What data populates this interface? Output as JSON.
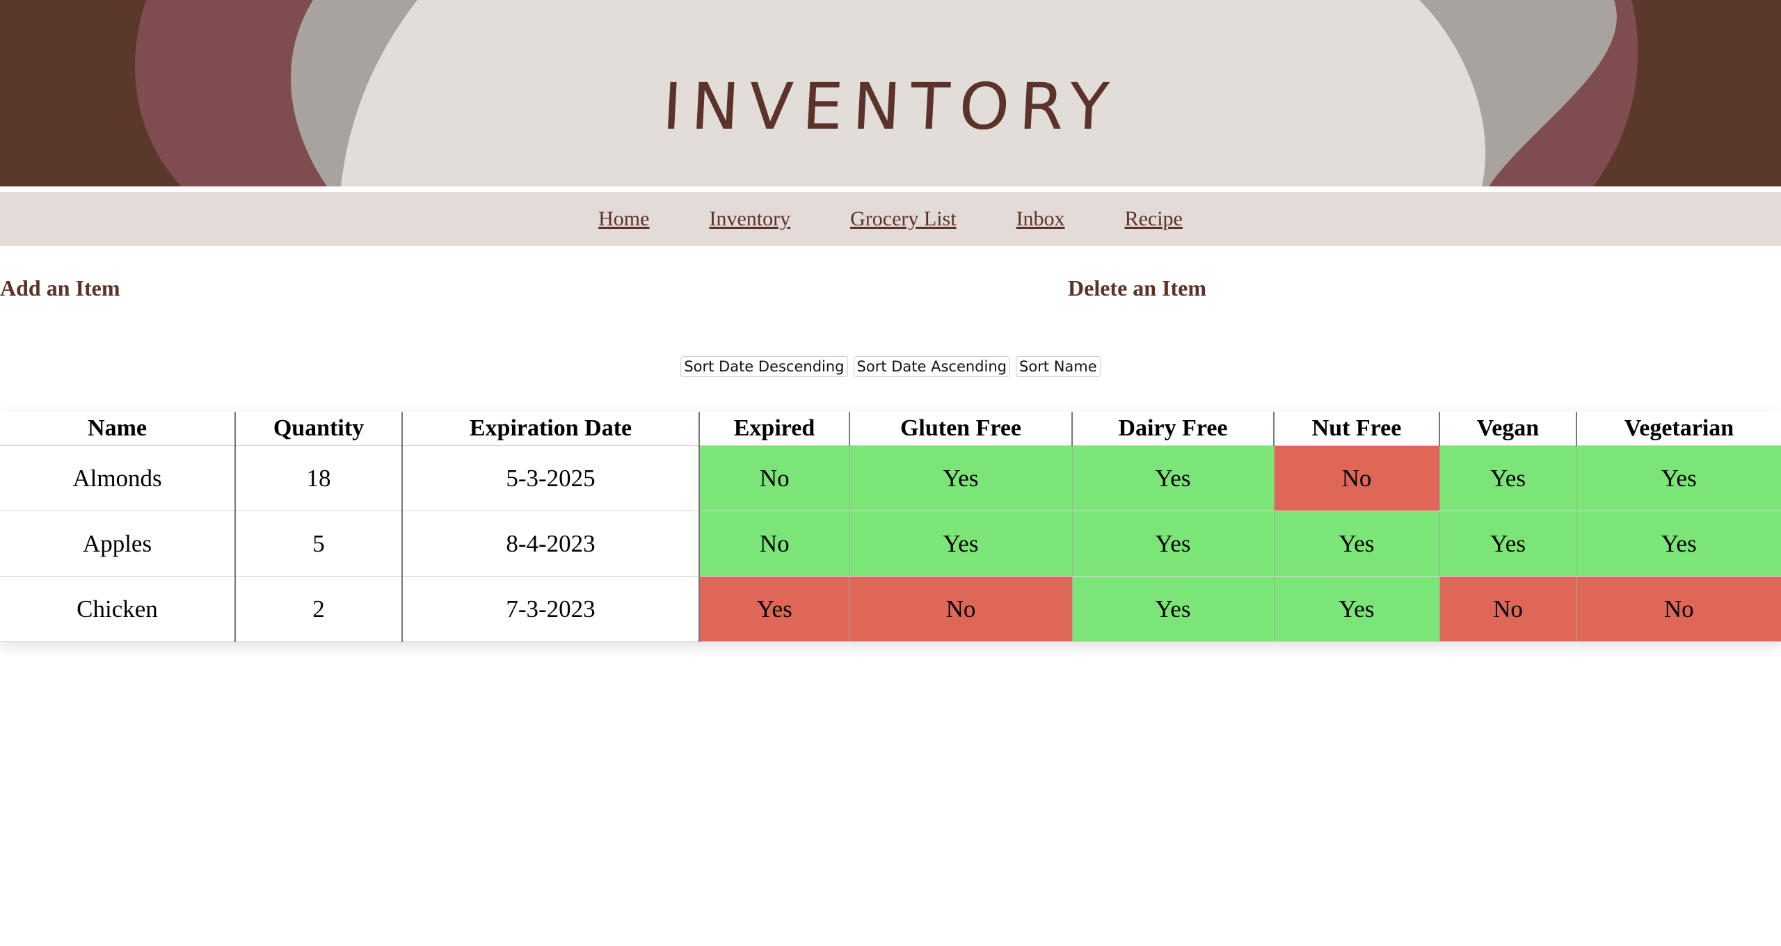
{
  "banner": {
    "title": "INVENTORY",
    "colors": {
      "outer": "#5b382c",
      "mid": "#7f4d4f",
      "inner": "#a8a39e",
      "center": "#e2ddd8"
    }
  },
  "nav": {
    "items": [
      {
        "label": "Home"
      },
      {
        "label": "Inventory"
      },
      {
        "label": "Grocery List"
      },
      {
        "label": "Inbox"
      },
      {
        "label": "Recipe"
      }
    ]
  },
  "actions": {
    "add_label": "Add an Item",
    "delete_label": "Delete an Item"
  },
  "sort": {
    "desc_label": "Sort Date Descending",
    "asc_label": "Sort Date Ascending",
    "name_label": "Sort Name"
  },
  "table": {
    "headers": [
      "Name",
      "Quantity",
      "Expiration Date",
      "Expired",
      "Gluten Free",
      "Dairy Free",
      "Nut Free",
      "Vegan",
      "Vegetarian"
    ],
    "rows": [
      {
        "name": "Almonds",
        "quantity": "18",
        "expiration": "5-3-2025",
        "expired": "No",
        "gluten_free": "Yes",
        "dairy_free": "Yes",
        "nut_free": "No",
        "vegan": "Yes",
        "vegetarian": "Yes"
      },
      {
        "name": "Apples",
        "quantity": "5",
        "expiration": "8-4-2023",
        "expired": "No",
        "gluten_free": "Yes",
        "dairy_free": "Yes",
        "nut_free": "Yes",
        "vegan": "Yes",
        "vegetarian": "Yes"
      },
      {
        "name": "Chicken",
        "quantity": "2",
        "expiration": "7-3-2023",
        "expired": "Yes",
        "gluten_free": "No",
        "dairy_free": "Yes",
        "nut_free": "Yes",
        "vegan": "No",
        "vegetarian": "No"
      }
    ]
  },
  "colors": {
    "good": "#7ce577",
    "bad": "#de6757",
    "accent": "#5b3328"
  }
}
